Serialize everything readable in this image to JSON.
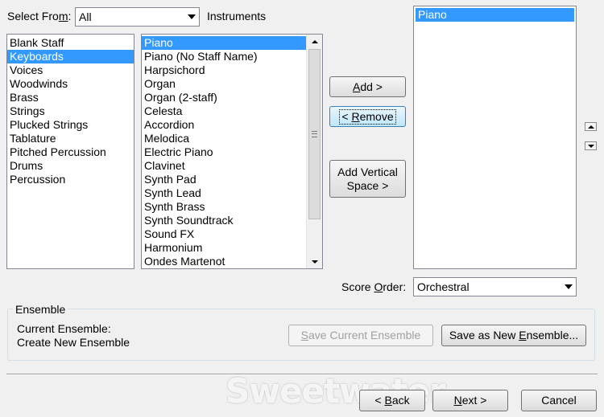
{
  "select_from": {
    "label_pre": "Select Fro",
    "label_ul": "m",
    "label_post": ":",
    "value": "All",
    "trailing_label": "Instruments"
  },
  "families": {
    "items": [
      {
        "label": "Blank Staff",
        "selected": false
      },
      {
        "label": "Keyboards",
        "selected": true
      },
      {
        "label": "Voices",
        "selected": false
      },
      {
        "label": "Woodwinds",
        "selected": false
      },
      {
        "label": "Brass",
        "selected": false
      },
      {
        "label": "Strings",
        "selected": false
      },
      {
        "label": "Plucked Strings",
        "selected": false
      },
      {
        "label": "Tablature",
        "selected": false
      },
      {
        "label": "Pitched Percussion",
        "selected": false
      },
      {
        "label": "Drums",
        "selected": false
      },
      {
        "label": "Percussion",
        "selected": false
      }
    ]
  },
  "instruments": {
    "items": [
      {
        "label": "Piano",
        "selected": true
      },
      {
        "label": "Piano (No Staff Name)",
        "selected": false
      },
      {
        "label": "Harpsichord",
        "selected": false
      },
      {
        "label": "Organ",
        "selected": false
      },
      {
        "label": "Organ (2-staff)",
        "selected": false
      },
      {
        "label": "Celesta",
        "selected": false
      },
      {
        "label": "Accordion",
        "selected": false
      },
      {
        "label": "Melodica",
        "selected": false
      },
      {
        "label": "Electric Piano",
        "selected": false
      },
      {
        "label": "Clavinet",
        "selected": false
      },
      {
        "label": "Synth Pad",
        "selected": false
      },
      {
        "label": "Synth Lead",
        "selected": false
      },
      {
        "label": "Synth Brass",
        "selected": false
      },
      {
        "label": "Synth Soundtrack",
        "selected": false
      },
      {
        "label": "Sound FX",
        "selected": false
      },
      {
        "label": "Harmonium",
        "selected": false
      },
      {
        "label": "Ondes Martenot",
        "selected": false
      }
    ]
  },
  "buttons": {
    "add_ul": "A",
    "add_post": "dd >",
    "remove_pre": "< ",
    "remove_ul": "R",
    "remove_post": "emove",
    "add_vertical_space_line1": "Add Vertical",
    "add_vertical_space_line2": "Space >"
  },
  "selected_instruments": {
    "items": [
      {
        "label": "Piano",
        "selected": true
      }
    ]
  },
  "score_order": {
    "label_pre": "Score ",
    "label_ul": "O",
    "label_post": "rder:",
    "value": "Orchestral"
  },
  "ensemble": {
    "group_title": "Ensemble",
    "current_label": "Current Ensemble:",
    "current_value": "Create New Ensemble",
    "save_current_pre": "",
    "save_current_ul": "S",
    "save_current_post": "ave Current Ensemble",
    "save_new_pre": "Save as New ",
    "save_new_ul": "E",
    "save_new_post": "nsemble..."
  },
  "footer": {
    "back_pre": "< ",
    "back_ul": "B",
    "back_post": "ack",
    "next_ul": "N",
    "next_post": "ext >",
    "cancel": "Cancel"
  },
  "watermark": "Sweetwater",
  "colors": {
    "selection": "#3399ff",
    "window": "#f0f0f0"
  }
}
